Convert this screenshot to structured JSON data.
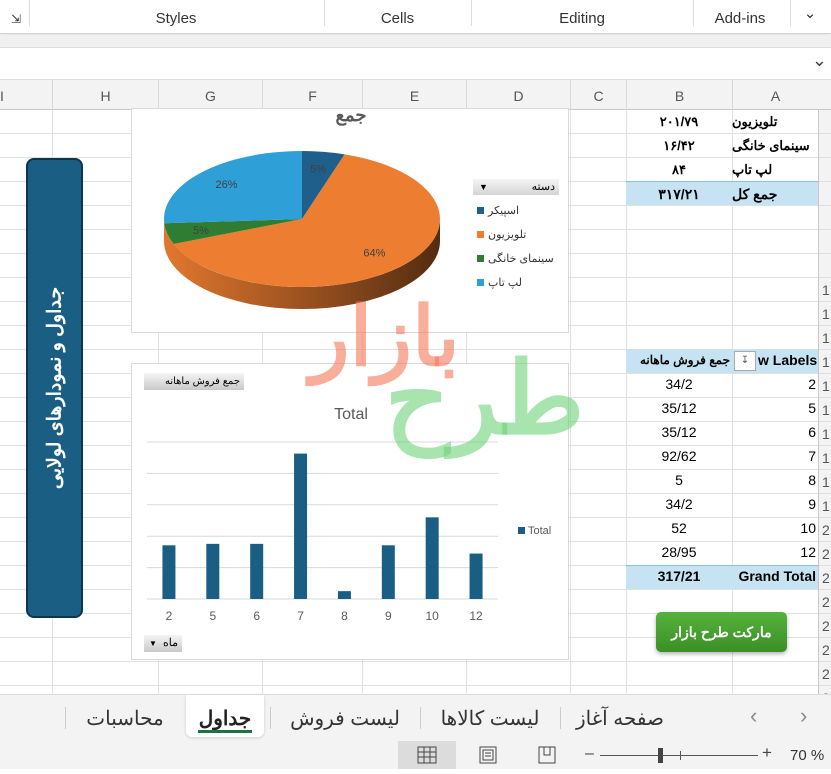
{
  "ribbon": {
    "groups": [
      "Styles",
      "Cells",
      "Editing",
      "Add-ins"
    ],
    "collapse_icon": "chevron-up-icon",
    "launcher_icon": "dialog-launcher-icon"
  },
  "formula_bar": {
    "expand_icon": "chevron-down-icon"
  },
  "columns": [
    "I",
    "H",
    "G",
    "F",
    "E",
    "D",
    "C",
    "B",
    "A"
  ],
  "row_numbers": [
    "",
    "",
    "",
    "",
    "",
    "",
    "",
    "1",
    "1",
    "1",
    "1",
    "1",
    "1",
    "1",
    "1",
    "1",
    "1",
    "2",
    "2",
    "2",
    "2",
    "2",
    "2",
    "2",
    "2"
  ],
  "summary_table": {
    "rows": [
      {
        "label": "تلویزیون",
        "value": "۲۰۱/۷۹"
      },
      {
        "label": "سینمای خانگی",
        "value": "۱۶/۴۲"
      },
      {
        "label": "لپ تاپ",
        "value": "۸۴"
      }
    ],
    "total": {
      "label": "جمع کل",
      "value": "۳۱۷/۲۱"
    }
  },
  "pivot": {
    "header_rows": "w Labels",
    "header_values": "جمع فروش ماهانه",
    "rows": [
      {
        "label": "2",
        "value": "34/2"
      },
      {
        "label": "5",
        "value": "35/12"
      },
      {
        "label": "6",
        "value": "35/12"
      },
      {
        "label": "7",
        "value": "92/62"
      },
      {
        "label": "8",
        "value": "5"
      },
      {
        "label": "9",
        "value": "34/2"
      },
      {
        "label": "10",
        "value": "52"
      },
      {
        "label": "12",
        "value": "28/95"
      }
    ],
    "total": {
      "label": "Grand Total",
      "value": "317/21"
    }
  },
  "banner": {
    "text": "جداول و نمودارهای لولایی"
  },
  "green_button": {
    "label": "مارکت طرح بازار"
  },
  "watermark": {
    "line1": "بازار",
    "line2": "طرح"
  },
  "chart_data": [
    {
      "type": "pie",
      "title": "جمع",
      "legend_title": "دسته",
      "legend_position": "right",
      "categories": [
        "اسپیکر",
        "تلویزیون",
        "سینمای خانگی",
        "لپ تاپ"
      ],
      "values": [
        5,
        64,
        5,
        26
      ],
      "labels": [
        "5%",
        "64%",
        "5%",
        "26%"
      ],
      "colors": [
        "#1f5f8b",
        "#ed7d31",
        "#2e7d32",
        "#2f9fd8"
      ]
    },
    {
      "type": "bar",
      "title": "Total",
      "field_button": "جمع فروش ماهانه",
      "axis_button": "ماه",
      "categories": [
        "2",
        "5",
        "6",
        "7",
        "8",
        "9",
        "10",
        "12"
      ],
      "series": [
        {
          "name": "Total",
          "values": [
            34.2,
            35.12,
            35.12,
            92.62,
            5,
            34.2,
            52,
            28.95
          ],
          "color": "#1a5e84"
        }
      ],
      "ylim": [
        0,
        100
      ],
      "grid": true,
      "legend_position": "right"
    }
  ],
  "sheet_tabs": [
    {
      "label": "صفحه آغاز",
      "active": false
    },
    {
      "label": "لیست کالاها",
      "active": false
    },
    {
      "label": "لیست فروش",
      "active": false
    },
    {
      "label": "جداول",
      "active": true
    },
    {
      "label": "محاسبات",
      "active": false
    }
  ],
  "status": {
    "zoom": "70 %"
  }
}
